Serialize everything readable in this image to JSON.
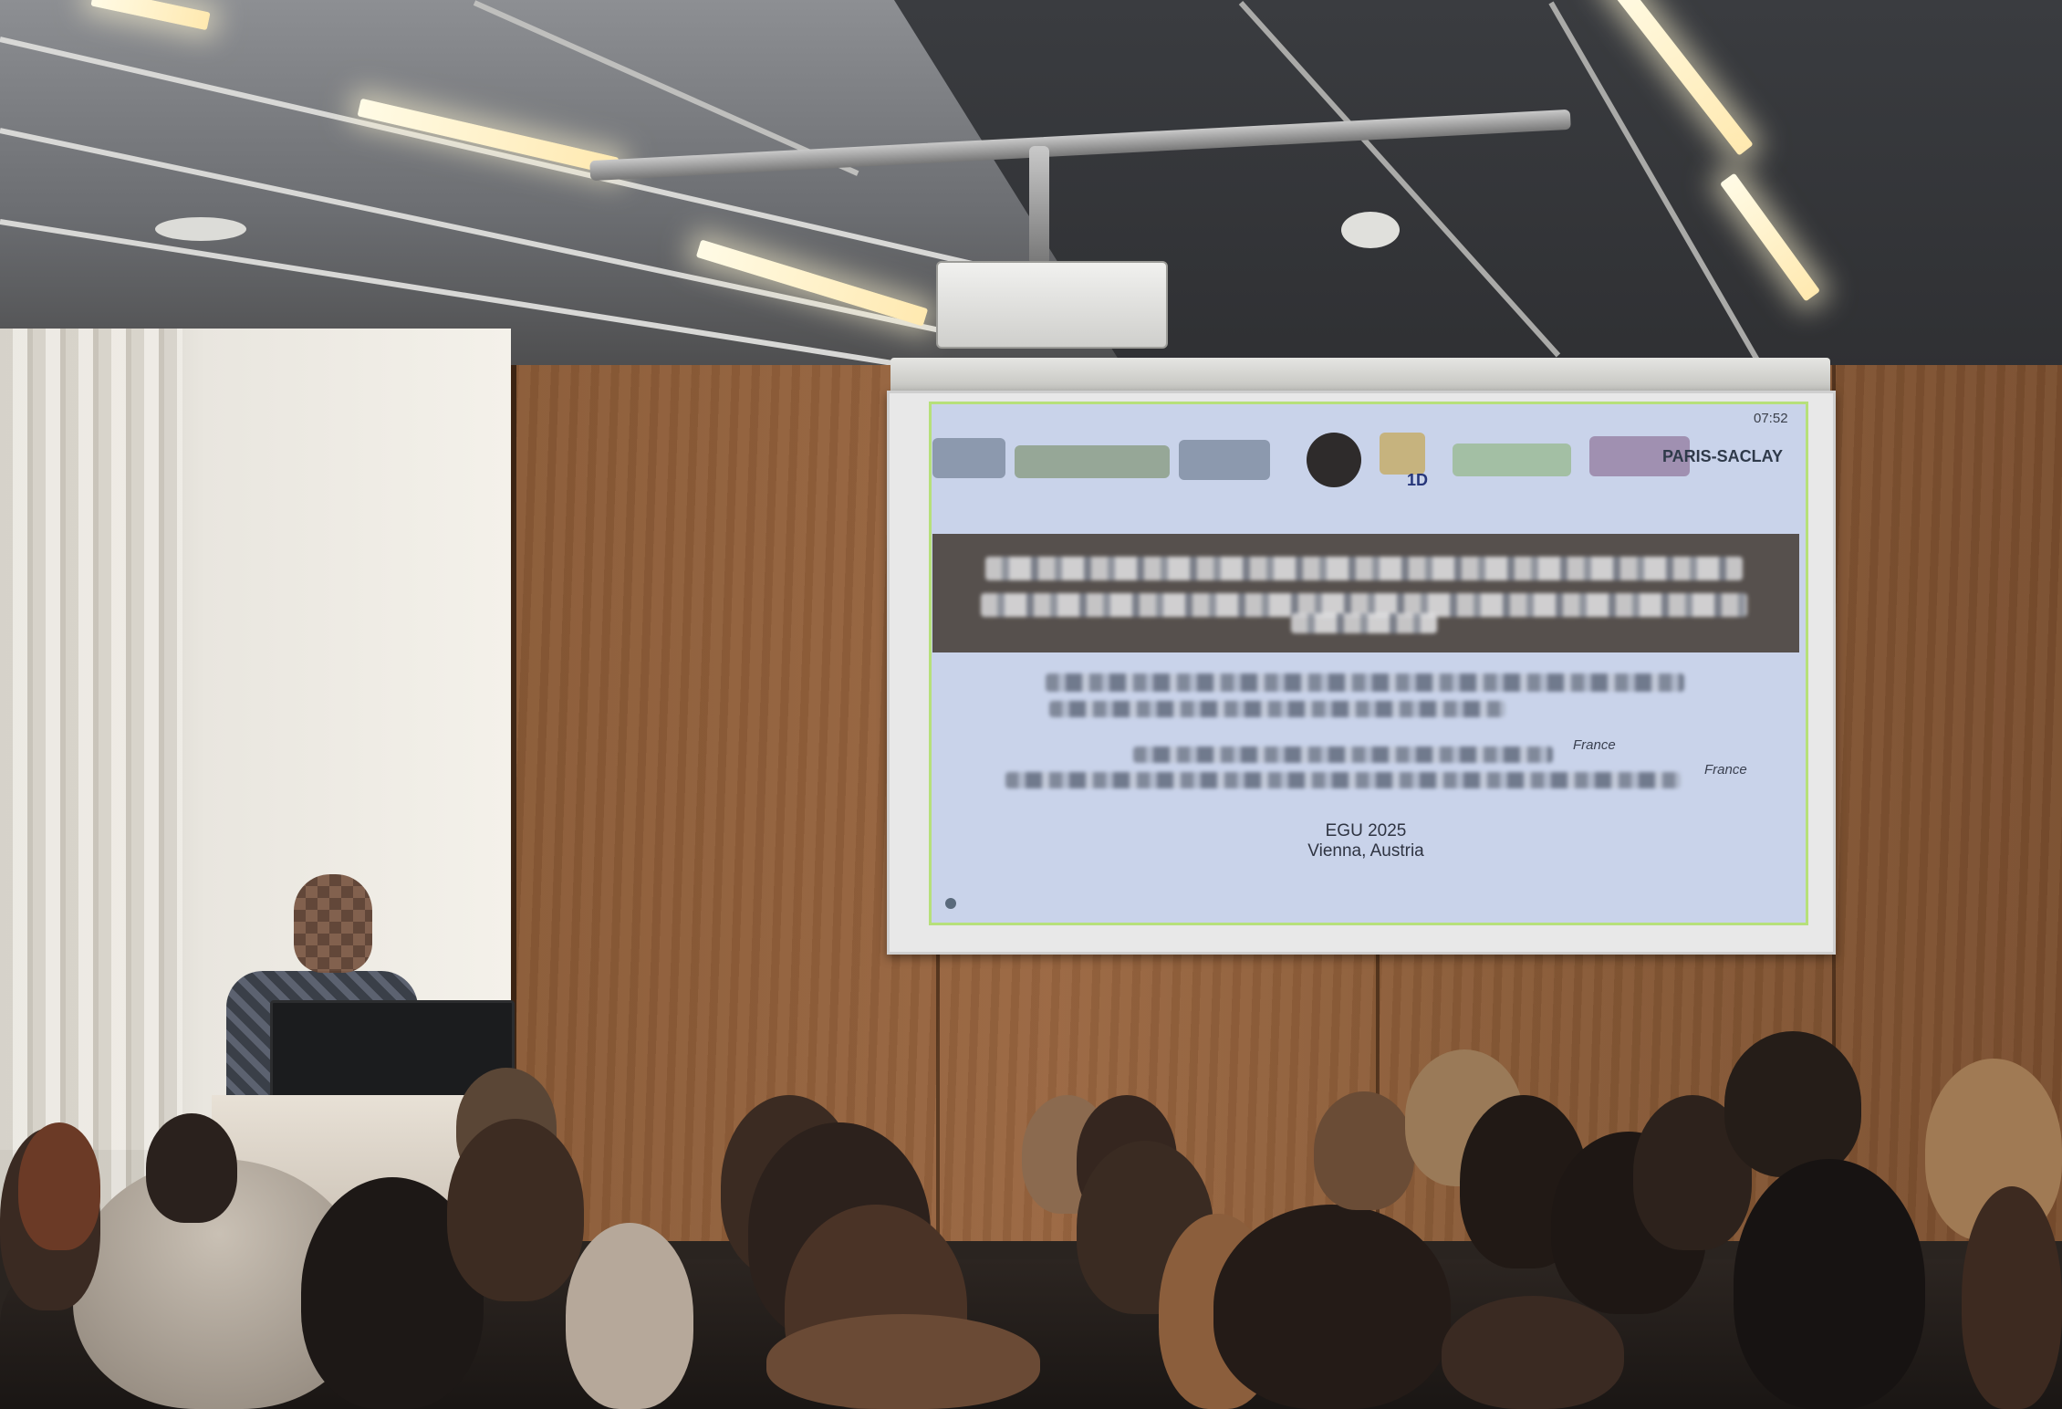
{
  "scene": {
    "description_tag": "conference-talk-photo"
  },
  "slide": {
    "clock": "07:52",
    "logo_text_right": "PARIS-SACLAY",
    "logo_text_1d": "1D",
    "event_line1": "EGU 2025",
    "event_line2": "Vienna, Austria",
    "partial_words": [
      "France",
      "France"
    ]
  },
  "colors": {
    "slide_background": "#c9d3ea",
    "title_band": "#56504d",
    "slide_border": "#b6e07a",
    "wood_wall": "#8a5a36"
  }
}
